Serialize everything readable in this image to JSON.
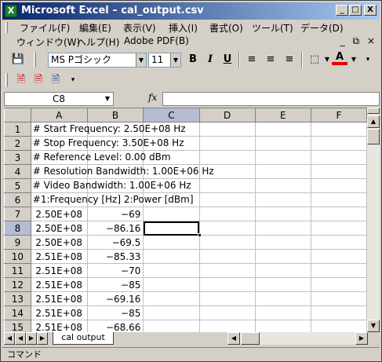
{
  "window": {
    "title": "Microsoft Excel – cal_output.csv",
    "min": "_",
    "max": "□",
    "close": "X"
  },
  "menu": {
    "row1": [
      "ファイル(F)",
      "編集(E)",
      "表示(V)",
      "挿入(I)",
      "書式(O)",
      "ツール(T)",
      "データ(D)"
    ],
    "row2": [
      "ウィンドウ(W)",
      "ヘルプ(H)",
      "Adobe PDF(B)"
    ],
    "doc_controls": [
      "_",
      "×"
    ]
  },
  "format_toolbar": {
    "font_name": "MS Pゴシック",
    "font_size": "11",
    "bold": "B",
    "italic": "I",
    "underline": "U",
    "font_color_label": "A",
    "font_color": "#e00000"
  },
  "formula_bar": {
    "name_box": "C8",
    "fx": "fx",
    "content": ""
  },
  "grid": {
    "columns": [
      "A",
      "B",
      "C",
      "D",
      "E",
      "F"
    ],
    "rows": [
      {
        "n": "1",
        "a": "# Start Frequency: 2.50E+08  Hz",
        "b": ""
      },
      {
        "n": "2",
        "a": "# Stop Frequency: 3.50E+08  Hz",
        "b": ""
      },
      {
        "n": "3",
        "a": "# Reference Level: 0.00 dBm",
        "b": ""
      },
      {
        "n": "4",
        "a": "# Resolution Bandwidth: 1.00E+06  Hz",
        "b": ""
      },
      {
        "n": "5",
        "a": "# Video Bandwidth: 1.00E+06  Hz",
        "b": ""
      },
      {
        "n": "6",
        "a": "#1:Frequency [Hz] 2:Power [dBm]",
        "b": ""
      },
      {
        "n": "7",
        "a": "2.50E+08",
        "b": "−69"
      },
      {
        "n": "8",
        "a": "2.50E+08",
        "b": "−86.16"
      },
      {
        "n": "9",
        "a": "2.50E+08",
        "b": "−69.5"
      },
      {
        "n": "10",
        "a": "2.51E+08",
        "b": "−85.33"
      },
      {
        "n": "11",
        "a": "2.51E+08",
        "b": "−70"
      },
      {
        "n": "12",
        "a": "2.51E+08",
        "b": "−85"
      },
      {
        "n": "13",
        "a": "2.51E+08",
        "b": "−69.16"
      },
      {
        "n": "14",
        "a": "2.51E+08",
        "b": "−85"
      },
      {
        "n": "15",
        "a": "2.51E+08",
        "b": "−68.66"
      }
    ]
  },
  "sheets": [
    "cal output"
  ],
  "status": "コマンド"
}
